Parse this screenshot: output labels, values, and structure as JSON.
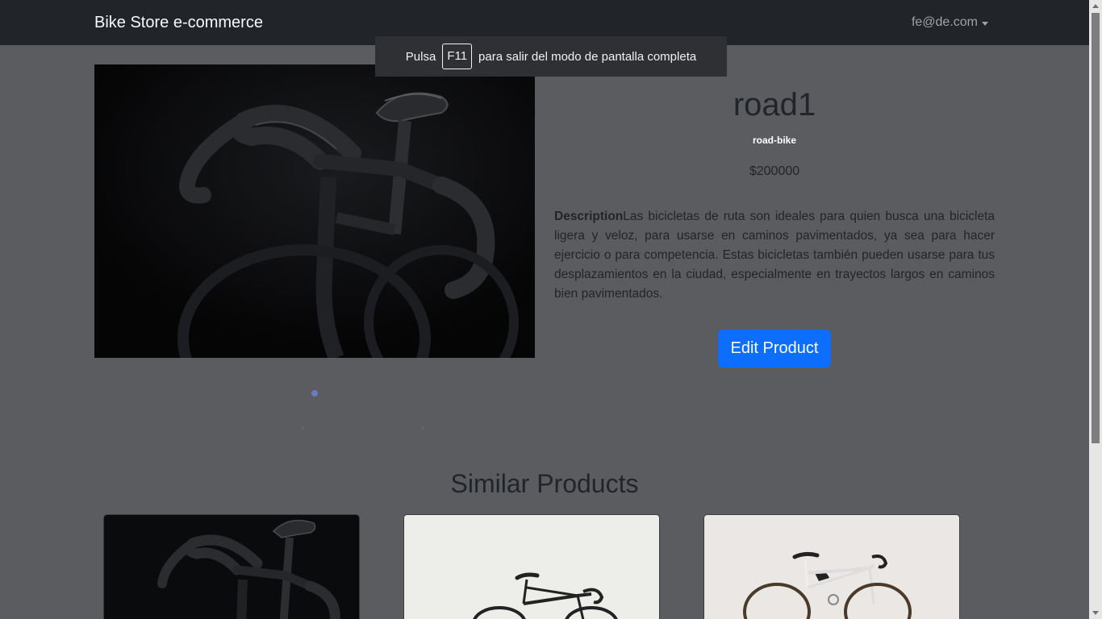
{
  "navbar": {
    "brand": "Bike Store e-commerce",
    "user_email": "fe@de.com"
  },
  "fullscreen_notice": {
    "prefix": "Pulsa",
    "key": "F11",
    "suffix": "para salir del modo de pantalla completa"
  },
  "product": {
    "name": "road1",
    "category": "road-bike",
    "price": "$200000",
    "description_label": "Description",
    "description": "Las bicicletas de ruta son ideales para quien busca una bicicleta ligera y veloz, para usarse en caminos pavimentados, ya sea para hacer ejercicio o para competencia. Estas bicicletas también pueden usarse para tus desplazamientos en la ciudad, especialmente en trayectos largos en caminos bien pavimentados.",
    "edit_button": "Edit Product"
  },
  "similar": {
    "title": "Similar Products"
  },
  "colors": {
    "navbar": "#212529",
    "page_overlay": "#5b5c5f",
    "primary_button": "#0d6efd"
  }
}
